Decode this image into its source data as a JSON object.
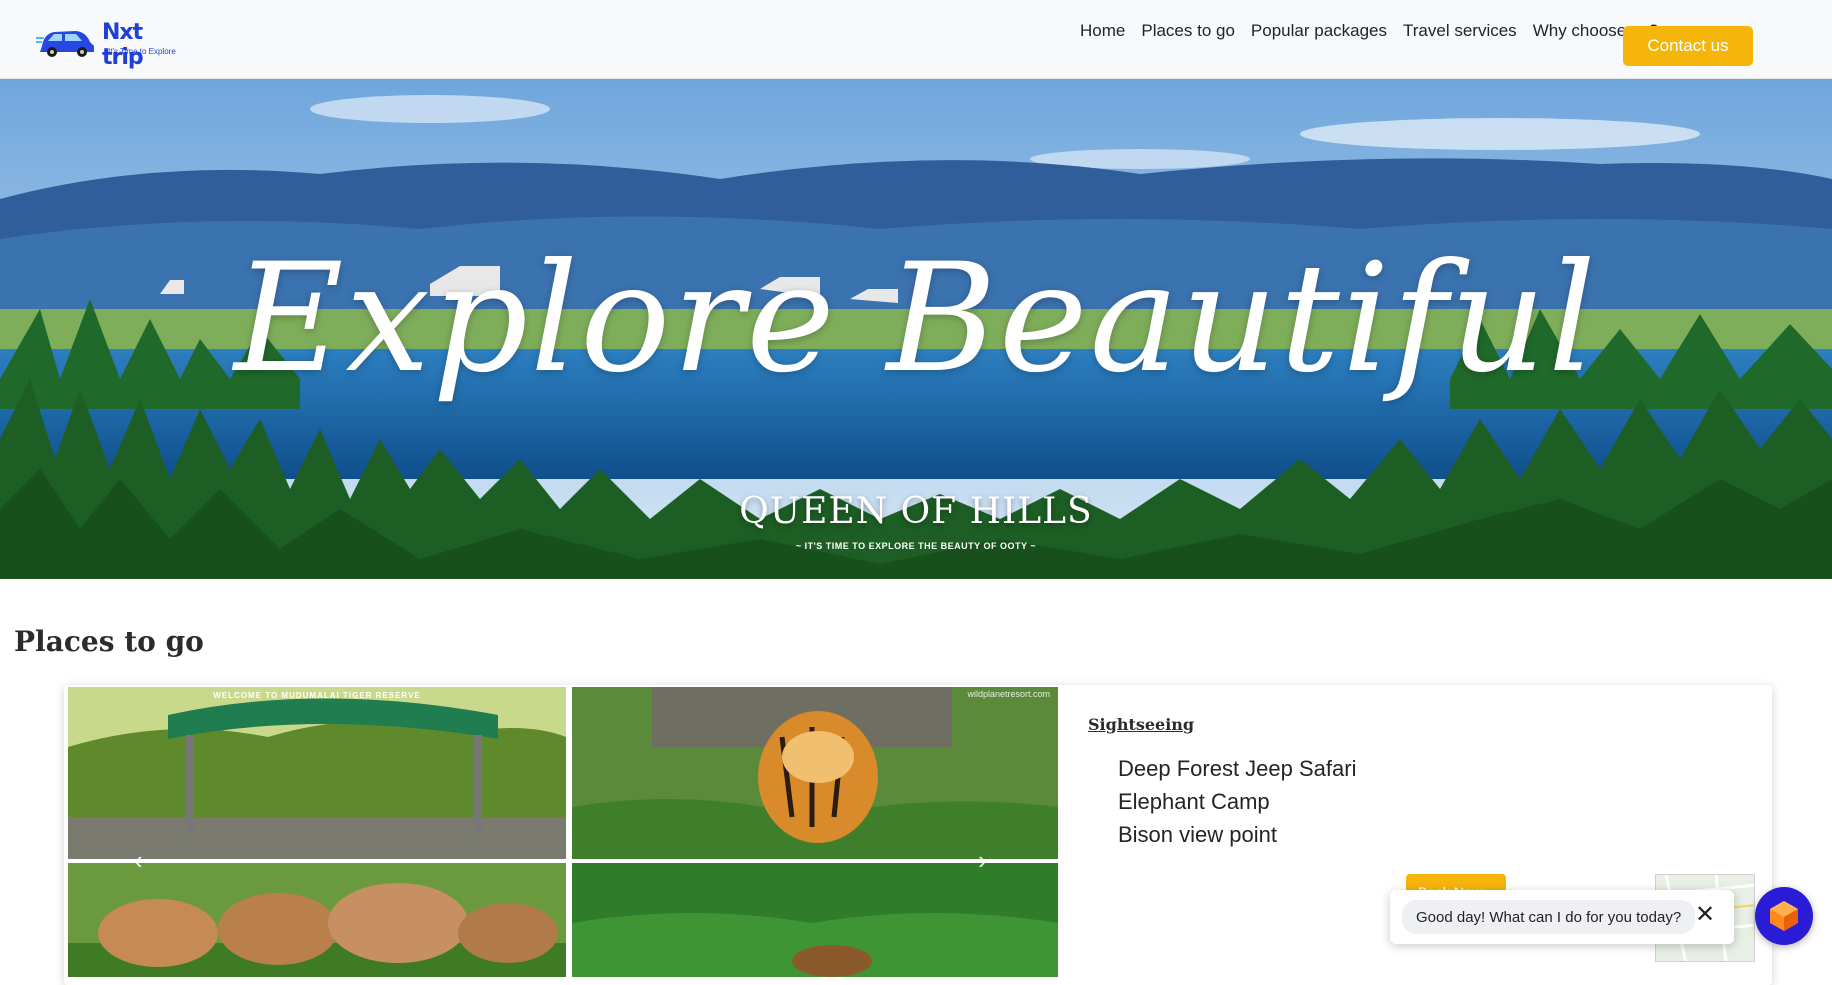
{
  "brand": {
    "name": "Nxt trip",
    "tagline": "It's Time to Explore"
  },
  "nav": {
    "items": [
      "Home",
      "Places to go",
      "Popular packages",
      "Travel services",
      "Why choose us?"
    ],
    "contact_label": "Contact us"
  },
  "hero": {
    "script_text": "Explore Beautiful",
    "title": "QUEEN OF HILLS",
    "subtitle": "~ IT'S TIME TO EXPLORE THE BEAUTY OF OOTY ~"
  },
  "places": {
    "section_title": "Places to go",
    "card": {
      "label": "Sightseeing",
      "items": [
        "Deep Forest Jeep Safari",
        "Elephant Camp",
        "Bison view point"
      ],
      "collage_sign_text": "WELCOME TO MUDUMALAI TIGER RESERVE",
      "collage_watermark": "wildplanetresort.com",
      "book_label": "Book Now"
    }
  },
  "chat": {
    "message": "Good day! What can I do for you today?"
  },
  "colors": {
    "accent": "#f5b50b",
    "brand": "#1f3fd6",
    "chat_launcher": "#2a1bd6"
  },
  "icons": [
    "car-logo-icon",
    "chevron-left-icon",
    "chevron-right-icon",
    "close-icon",
    "chat-cube-icon"
  ]
}
